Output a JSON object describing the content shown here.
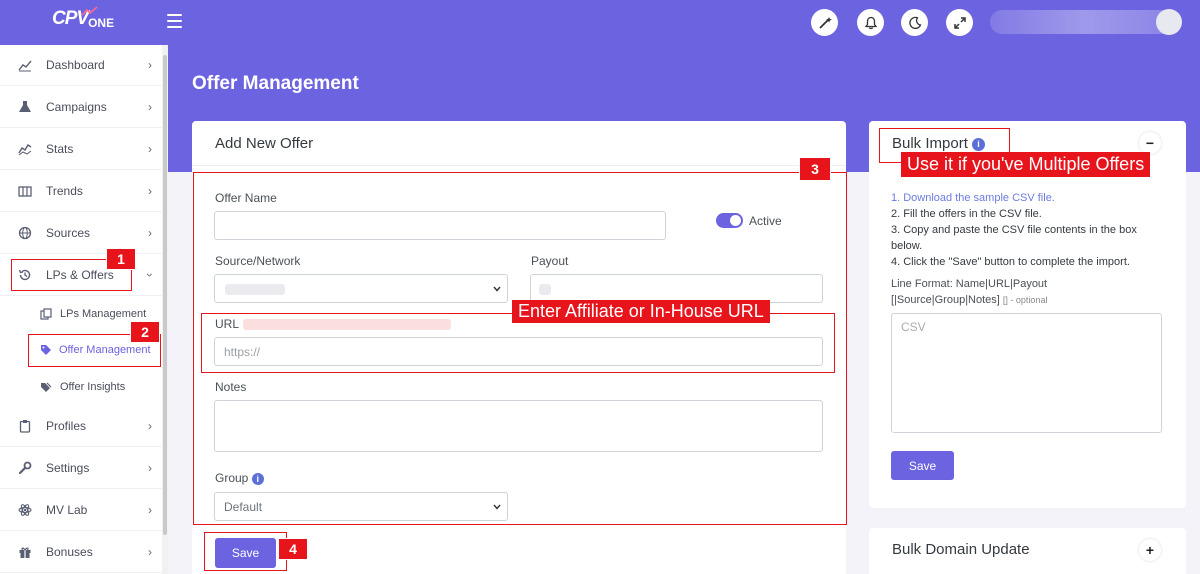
{
  "app": {
    "logo_main": "CPV",
    "logo_sub": "ONE"
  },
  "sidebar": {
    "items": [
      {
        "label": "Dashboard",
        "icon": "chart-line-icon"
      },
      {
        "label": "Campaigns",
        "icon": "flask-icon"
      },
      {
        "label": "Stats",
        "icon": "stats-icon"
      },
      {
        "label": "Trends",
        "icon": "columns-icon"
      },
      {
        "label": "Sources",
        "icon": "globe-icon"
      },
      {
        "label": "LPs & Offers",
        "icon": "history-icon"
      },
      {
        "label": "Profiles",
        "icon": "clipboard-icon"
      },
      {
        "label": "Settings",
        "icon": "wrench-icon"
      },
      {
        "label": "MV Lab",
        "icon": "react-icon"
      },
      {
        "label": "Bonuses",
        "icon": "gift-icon"
      }
    ],
    "sub_items": [
      {
        "label": "LPs Management",
        "icon": "copy-icon"
      },
      {
        "label": "Offer Management",
        "icon": "tag-icon"
      },
      {
        "label": "Offer Insights",
        "icon": "tags-icon"
      }
    ]
  },
  "page": {
    "title": "Offer Management"
  },
  "add_offer": {
    "title": "Add New Offer",
    "offer_name_label": "Offer Name",
    "active_label": "Active",
    "source_label": "Source/Network",
    "payout_label": "Payout",
    "url_label": "URL",
    "url_placeholder": "https://",
    "notes_label": "Notes",
    "group_label": "Group",
    "group_value": "Default",
    "save_label": "Save"
  },
  "bulk_import": {
    "title": "Bulk Import",
    "collapse_symbol": "−",
    "step1": "1. Download the sample CSV file.",
    "step2": "2. Fill the offers in the CSV file.",
    "step3": "3. Copy and paste the CSV file contents in the box below.",
    "step4": "4. Click the \"Save\" button to complete the import.",
    "line_format_label": "Line Format: Name|URL|Payout [|Source|Group|Notes]",
    "optional_note": "[] - optional",
    "textarea_placeholder": "CSV",
    "save_label": "Save"
  },
  "bulk_domain": {
    "title": "Bulk Domain Update",
    "expand_symbol": "+"
  },
  "annotations": {
    "n1": "1",
    "n2": "2",
    "n3": "3",
    "n4": "4",
    "url_hint": "Enter Affiliate or In-House URL",
    "bulk_hint": "Use it if you've Multiple Offers"
  },
  "colors": {
    "accent": "#6c63e0",
    "annotation": "#e8141c"
  }
}
